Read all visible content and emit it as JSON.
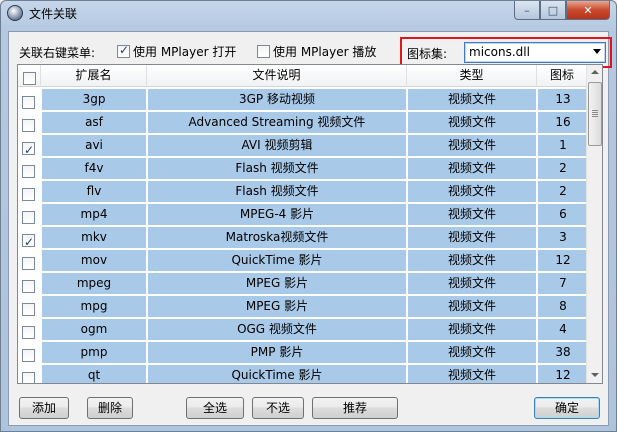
{
  "window": {
    "title": "文件关联",
    "controls": [
      "–",
      "□",
      "✕"
    ]
  },
  "context_menu": {
    "label": "关联右键菜单:",
    "opt_open": {
      "label": "使用 MPlayer 打开",
      "checked": true
    },
    "opt_play": {
      "label": "使用 MPlayer 播放",
      "checked": false
    }
  },
  "iconset": {
    "label": "图标集:",
    "value": "micons.dll"
  },
  "table": {
    "headers": [
      "扩展名",
      "文件说明",
      "类型",
      "图标"
    ],
    "rows": [
      {
        "checked": false,
        "ext": "3gp",
        "desc": "3GP 移动视频",
        "type": "视频文件",
        "icon": "13"
      },
      {
        "checked": false,
        "ext": "asf",
        "desc": "Advanced Streaming 视频文件",
        "type": "视频文件",
        "icon": "16"
      },
      {
        "checked": true,
        "ext": "avi",
        "desc": "AVI 视频剪辑",
        "type": "视频文件",
        "icon": "1"
      },
      {
        "checked": false,
        "ext": "f4v",
        "desc": "Flash 视频文件",
        "type": "视频文件",
        "icon": "2"
      },
      {
        "checked": false,
        "ext": "flv",
        "desc": "Flash 视频文件",
        "type": "视频文件",
        "icon": "2"
      },
      {
        "checked": false,
        "ext": "mp4",
        "desc": "MPEG-4 影片",
        "type": "视频文件",
        "icon": "6"
      },
      {
        "checked": true,
        "ext": "mkv",
        "desc": "Matroska视频文件",
        "type": "视频文件",
        "icon": "3"
      },
      {
        "checked": false,
        "ext": "mov",
        "desc": "QuickTime 影片",
        "type": "视频文件",
        "icon": "12"
      },
      {
        "checked": false,
        "ext": "mpeg",
        "desc": "MPEG 影片",
        "type": "视频文件",
        "icon": "7"
      },
      {
        "checked": false,
        "ext": "mpg",
        "desc": "MPEG 影片",
        "type": "视频文件",
        "icon": "8"
      },
      {
        "checked": false,
        "ext": "ogm",
        "desc": "OGG 视频文件",
        "type": "视频文件",
        "icon": "4"
      },
      {
        "checked": false,
        "ext": "pmp",
        "desc": "PMP 影片",
        "type": "视频文件",
        "icon": "38"
      },
      {
        "checked": false,
        "ext": "qt",
        "desc": "QuickTime 影片",
        "type": "视频文件",
        "icon": "12"
      }
    ]
  },
  "buttons": {
    "add": "添加",
    "delete": "删除",
    "select_all": "全选",
    "select_none": "不选",
    "recommend": "推荐",
    "ok": "确定"
  }
}
